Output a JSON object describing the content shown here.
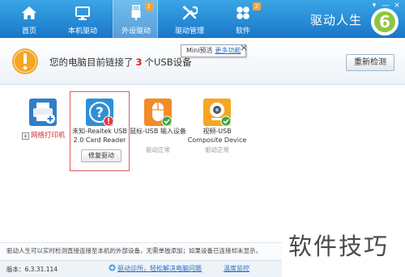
{
  "window": {
    "controls": [
      "▾",
      "—",
      "×"
    ]
  },
  "nav": {
    "tabs": [
      {
        "label": "首页",
        "icon": "home-icon",
        "badge": ""
      },
      {
        "label": "本机驱动",
        "icon": "monitor-icon",
        "badge": ""
      },
      {
        "label": "外设驱动",
        "icon": "usb-icon",
        "badge": "1"
      },
      {
        "label": "驱动管理",
        "icon": "tools-icon",
        "badge": ""
      },
      {
        "label": "软件",
        "icon": "apps-icon",
        "badge": "2"
      }
    ],
    "active_index": 2
  },
  "brand": {
    "name": "驱动人生",
    "logo_digit": "6"
  },
  "status": {
    "prefix": "您的电脑目前链接了",
    "count": "3",
    "suffix": "个USB设备",
    "icon": "warning-icon"
  },
  "tooltip": {
    "text": "Mini预活",
    "link": "更多功能"
  },
  "rescan_label": "重新检测",
  "net_printer_label": "网络打印机",
  "devices": [
    {
      "name_line1": "未知-Realtek USB",
      "name_line2": "2.0 Card Reader",
      "status": "",
      "action": "修复驱动",
      "icon": "unknown-device-icon"
    },
    {
      "name_line1": "鼠标-USB 输入设备",
      "name_line2": "",
      "status": "驱动正常",
      "icon": "mouse-icon"
    },
    {
      "name_line1": "视频-USB",
      "name_line2": "Composite Device",
      "status": "驱动正常",
      "icon": "webcam-icon"
    }
  ],
  "info_text": "驱动人生可以实时检测直接连接至本机的外部设备，无需单独添加；如果设备已连接却未显示，",
  "footer": {
    "version": "版本：6.3.31.114",
    "link1": "驱动诊所，轻松解决电脑问题",
    "link2": "温度监控"
  },
  "watermark": "软件技巧",
  "colors": {
    "topbar": "#1f83d1",
    "accent_red": "#e52222",
    "warning": "#f5a623",
    "ok_green": "#3ea63e"
  }
}
